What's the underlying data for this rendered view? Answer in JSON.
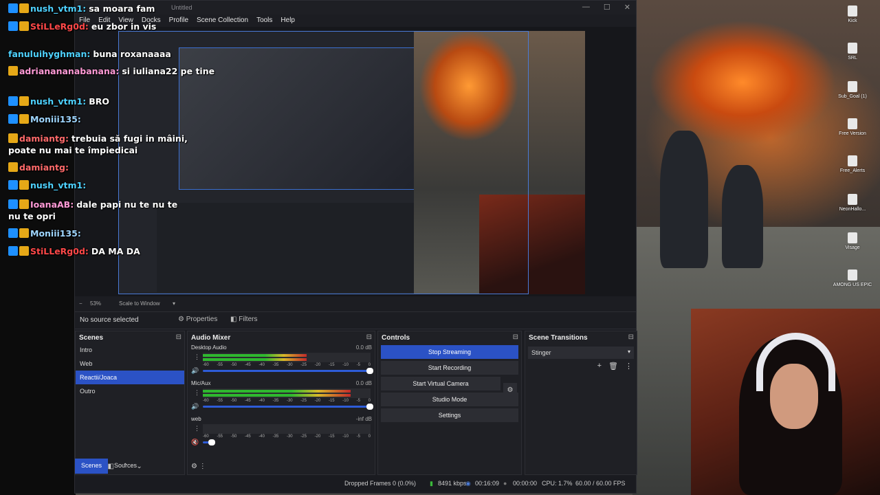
{
  "window": {
    "title": "Untitled",
    "minimize": "—",
    "maximize": "☐",
    "close": "✕"
  },
  "menu": [
    "File",
    "Edit",
    "View",
    "Docks",
    "Profile",
    "Scene Collection",
    "Tools",
    "Help"
  ],
  "scale": {
    "zoom": "53%",
    "mode": "Scale to Window"
  },
  "source_bar": {
    "no_source": "No source selected",
    "properties": "Properties",
    "filters": "Filters"
  },
  "scenes": {
    "title": "Scenes",
    "items": [
      {
        "label": "Intro"
      },
      {
        "label": "Web"
      },
      {
        "label": "Reactii/Joaca",
        "active": true
      },
      {
        "label": "Outro"
      }
    ]
  },
  "mixer": {
    "title": "Audio Mixer",
    "channels": [
      {
        "name": "Desktop Audio",
        "db": "0.0 dB",
        "level": 0.62
      },
      {
        "name": "Mic/Aux",
        "db": "0.0 dB",
        "level": 0.88
      },
      {
        "name": "web",
        "db": "-inf dB",
        "level": 0.0
      }
    ],
    "ticks": [
      "-60",
      "-55",
      "-50",
      "-45",
      "-40",
      "-35",
      "-30",
      "-25",
      "-20",
      "-15",
      "-10",
      "-5",
      "0"
    ]
  },
  "controls": {
    "title": "Controls",
    "stop_streaming": "Stop Streaming",
    "start_recording": "Start Recording",
    "start_virtual_camera": "Start Virtual Camera",
    "studio_mode": "Studio Mode",
    "settings": "Settings"
  },
  "transitions": {
    "title": "Scene Transitions",
    "selected": "Stinger"
  },
  "tabs": {
    "scenes": "Scenes",
    "sources": "Sources"
  },
  "status": {
    "dropped": "Dropped Frames 0 (0.0%)",
    "bitrate": "8491 kbps",
    "stream_time": "00:16:09",
    "rec_time": "00:00:00",
    "cpu": "CPU: 1.7%",
    "fps": "60.00 / 60.00 FPS"
  },
  "chat": [
    {
      "user": "nush_vtm1:",
      "msg": "sa moara fam",
      "color": "#4ed2ff"
    },
    {
      "user": "StiLLeRg0d:",
      "msg": "eu zbor in vis",
      "color": "#ff4848"
    },
    {
      "user": "fanuluihyghman:",
      "msg": "buna roxanaaaa",
      "color": "#4ed2ff"
    },
    {
      "user": "adrianananabanana:",
      "msg": "si iuliana22 pe tine",
      "color": "#ff9ad6"
    },
    {
      "user": "nush_vtm1:",
      "msg": "BRO",
      "color": "#4ed2ff"
    },
    {
      "user": "Moniii135:",
      "msg": "",
      "color": "#9fd6ff"
    },
    {
      "user": "damiantg:",
      "msg": "trebuia să fugi in mâini, poate nu mai te împiedicai",
      "color": "#ff6a6a"
    },
    {
      "user": "damiantg:",
      "msg": "",
      "color": "#ff6a6a"
    },
    {
      "user": "nush_vtm1:",
      "msg": "",
      "color": "#4ed2ff"
    },
    {
      "user": "IoanaAB:",
      "msg": "dale papi nu te nu te nu te opri",
      "color": "#ff9ad6"
    },
    {
      "user": "Moniii135:",
      "msg": "",
      "color": "#9fd6ff"
    },
    {
      "user": "StiLLeRg0d:",
      "msg": "DA MA DA",
      "color": "#ff4848"
    }
  ],
  "desktop_icons": [
    "Kick",
    "SRL",
    "Sub_Goal (1)",
    "Free Version",
    "Free_Alerts",
    "NeonHallo...",
    "Visage",
    "AMONG US EPIC"
  ]
}
